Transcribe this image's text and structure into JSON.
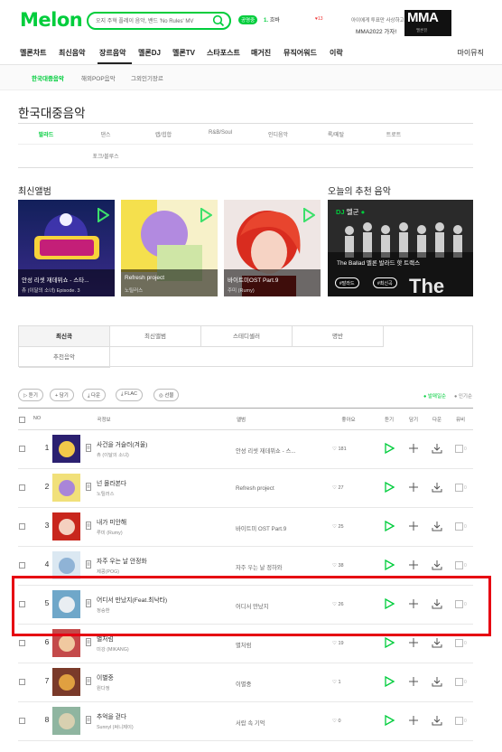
{
  "header": {
    "logo": "Melon",
    "search_placeholder": "오지 주혁 플레이 음악, 밴드 'No Rules' MV",
    "shop_badge": "공명중",
    "rank_num": "1.",
    "rank_label": "흐바",
    "notice": "♥13",
    "promo_line1": "아이에게 투표만 사상하고",
    "promo_line2": "MMA2022 가자!",
    "mma_logo": "MMA",
    "mma_sub": "멜론뮤"
  },
  "gnb": {
    "items": [
      "멜론차트",
      "최신음악",
      "장르음악",
      "멜론DJ",
      "멜론TV",
      "스타포스트",
      "매거진",
      "뮤직어워드",
      "이락"
    ],
    "active_index": 2,
    "mymusic": "마이뮤직"
  },
  "subnav": {
    "items": [
      "한국대중음악",
      "해외POP음악",
      "그외인기장르"
    ],
    "active_index": 0
  },
  "page_title": "한국대중음악",
  "genres": {
    "row1": [
      "발라드",
      "댄스",
      "랩/힙합",
      "R&B/Soul",
      "인디음악",
      "록/메탈",
      "트로트"
    ],
    "row2": [
      "포크/블루스"
    ],
    "active": "발라드"
  },
  "new_albums": {
    "title": "최신앨범",
    "items": [
      {
        "title": "안성 리셋 재데뷔쇼 - 스타...",
        "artist": "츄 (이달의 소녀) Episode. 3"
      },
      {
        "title": "Refresh project",
        "artist": "노틸러스"
      },
      {
        "title": "바이트미OST Part.9",
        "artist": "주미 (Rumy)"
      }
    ]
  },
  "recommend": {
    "title": "오늘의 추천 음악",
    "dj_label": "DJ",
    "dj_name": "멜군",
    "playlist_title": "The Ballad 멜론 발라드 핫 트랙스",
    "pills": [
      "#발라드",
      "#최신곡"
    ]
  },
  "list_tabs": [
    "최신곡",
    "최신앨범",
    "스테디셀러",
    "명반",
    "추천음악"
  ],
  "list_tabs_active": 0,
  "toolbar": {
    "buttons": [
      "듣기",
      "담기",
      "다운",
      "FLAC",
      "선물"
    ],
    "sort_options": [
      "발매일순",
      "인기순"
    ],
    "sort_active": 0
  },
  "table_header": {
    "no": "NO",
    "song": "곡정보",
    "album": "앨범",
    "like": "좋아요",
    "play": "듣기",
    "add": "담기",
    "download": "다운",
    "mv": "뮤비"
  },
  "songs": [
    {
      "rank": "1",
      "title": "사건을 거슬러(겨울)",
      "artist": "츄 (이달의 소녀)",
      "album": "안성 리셋 재데뷔쇼 - 스...",
      "likes": "181",
      "mv": "0"
    },
    {
      "rank": "2",
      "title": "넌 몰라본다",
      "artist": "노틸러스",
      "album": "Refresh project",
      "likes": "27",
      "mv": "0"
    },
    {
      "rank": "3",
      "title": "내가 미안해",
      "artist": "루미 (Rumy)",
      "album": "바이트미 OST Part.9",
      "likes": "25",
      "mv": "0"
    },
    {
      "rank": "4",
      "title": "자주 우는 날 안정화",
      "artist": "제콩(POG)",
      "album": "자주 우는 날 정하와",
      "likes": "38",
      "mv": "0"
    },
    {
      "rank": "5",
      "title": "어디서 만났지(Feat.최낙타)",
      "artist": "정승환",
      "album": "어디서 만났지",
      "likes": "26",
      "mv": "0"
    },
    {
      "rank": "6",
      "title": "별처럼",
      "artist": "미강 (MIKANG)",
      "album": "별처럼",
      "likes": "19",
      "mv": "0"
    },
    {
      "rank": "7",
      "title": "이별중",
      "artist": "원다정",
      "album": "이별중",
      "likes": "1",
      "mv": "0"
    },
    {
      "rank": "8",
      "title": "추억을 걷다",
      "artist": "Sunnyl (써니제이)",
      "album": "서랍 속 기억",
      "likes": "0",
      "mv": "0"
    }
  ],
  "colors": {
    "brand": "#00cd3c",
    "highlight": "#e60012"
  }
}
